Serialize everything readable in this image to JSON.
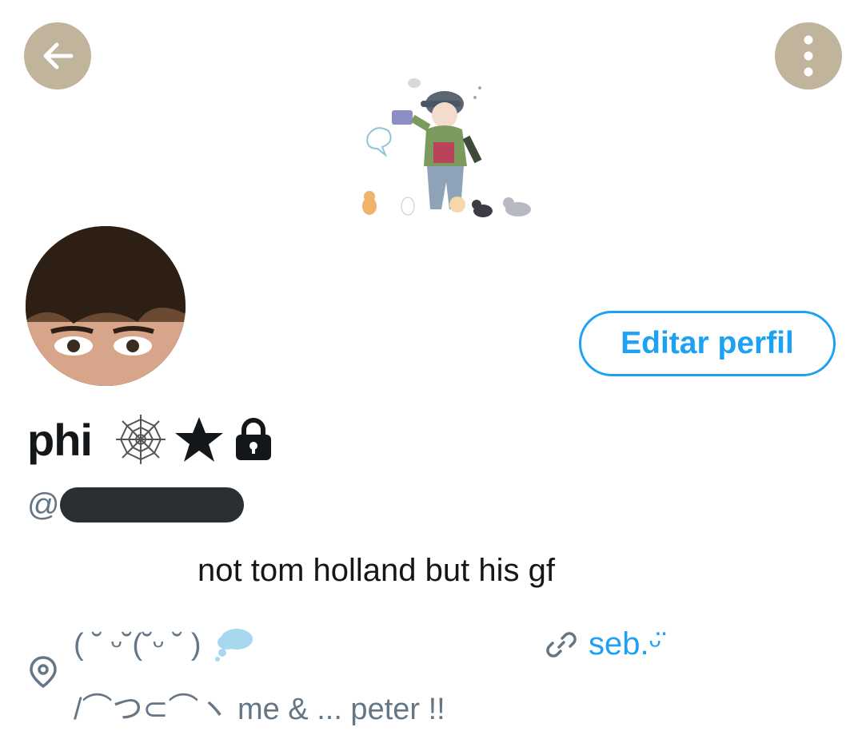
{
  "colors": {
    "nav_button_bg": "#c1b49c",
    "accent": "#1da1f2",
    "secondary_text": "#657786",
    "primary_text": "#14171a"
  },
  "nav": {
    "back_icon": "arrow-left-icon",
    "more_icon": "more-vertical-icon"
  },
  "profile": {
    "edit_button_label": "Editar perfil",
    "display_name": "phi",
    "name_decorations": [
      "spider-web-icon",
      "star-icon",
      "lock-icon"
    ],
    "handle_prefix": "@",
    "bio": "not tom holland but his gf",
    "location_line1": "( ˘ ᵕ˘(˘ᵕ ˘ )",
    "location_line2": "/⌒つ⊂⌒ヽ   me & ... peter !!",
    "link_text": "seb.ᵕ̈"
  }
}
